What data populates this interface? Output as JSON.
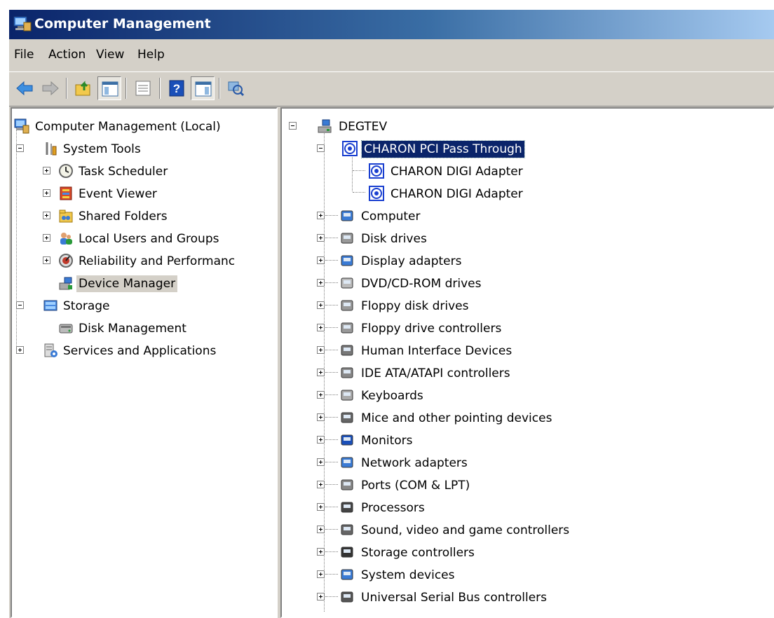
{
  "window": {
    "title": "Computer Management"
  },
  "menu": {
    "file": "File",
    "action": "Action",
    "view": "View",
    "help": "Help"
  },
  "toolbar": {
    "buttons": [
      "back-icon",
      "forward-icon",
      "up-folder-icon",
      "show-hide-console-tree-icon",
      "properties-icon",
      "help-icon",
      "show-hide-action-pane-icon",
      "scan-hardware-icon"
    ]
  },
  "left_tree": {
    "root": "Computer Management (Local)",
    "system_tools": "System Tools",
    "task_scheduler": "Task Scheduler",
    "event_viewer": "Event Viewer",
    "shared_folders": "Shared Folders",
    "local_users": "Local Users and Groups",
    "reliability": "Reliability and Performanc",
    "device_manager": "Device Manager",
    "storage": "Storage",
    "disk_management": "Disk Management",
    "services": "Services and Applications"
  },
  "device_tree": {
    "root": "DEGTEV",
    "selected": "CHARON PCI Pass Through",
    "children": [
      "CHARON DIGI Adapter",
      "CHARON DIGI Adapter"
    ],
    "categories": [
      "Computer",
      "Disk drives",
      "Display adapters",
      "DVD/CD-ROM drives",
      "Floppy disk drives",
      "Floppy drive controllers",
      "Human Interface Devices",
      "IDE ATA/ATAPI controllers",
      "Keyboards",
      "Mice and other pointing devices",
      "Monitors",
      "Network adapters",
      "Ports (COM & LPT)",
      "Processors",
      "Sound, video and game controllers",
      "Storage controllers",
      "System devices",
      "Universal Serial Bus controllers"
    ],
    "category_icons": [
      "computer-icon",
      "disk-drive-icon",
      "display-adapter-icon",
      "dvd-drive-icon",
      "floppy-drive-icon",
      "floppy-controller-icon",
      "hid-icon",
      "ide-controller-icon",
      "keyboard-icon",
      "mouse-icon",
      "monitor-icon",
      "network-adapter-icon",
      "port-icon",
      "processor-icon",
      "sound-icon",
      "storage-controller-icon",
      "system-device-icon",
      "usb-icon"
    ]
  }
}
